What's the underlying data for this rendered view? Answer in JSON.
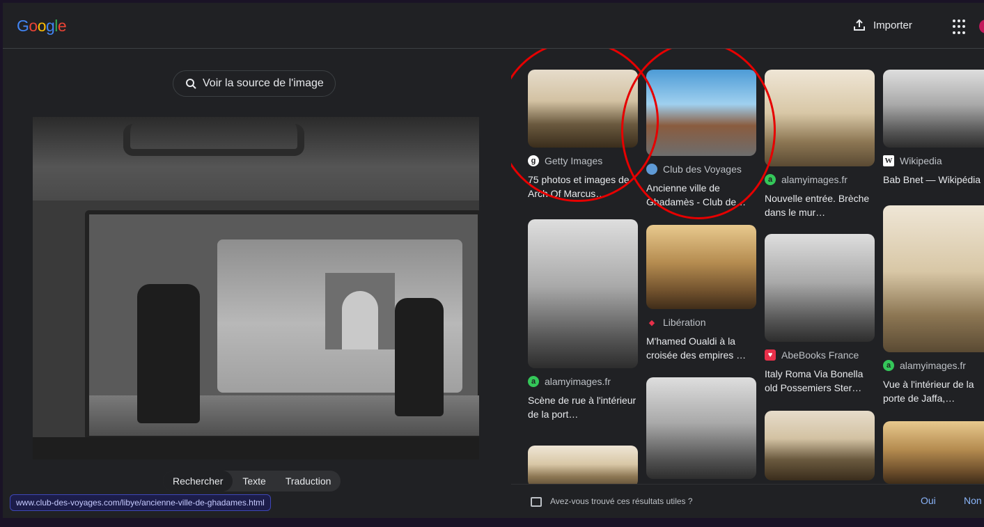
{
  "header": {
    "logo_letters": [
      {
        "ch": "G",
        "color": "#4285f4"
      },
      {
        "ch": "o",
        "color": "#ea4335"
      },
      {
        "ch": "o",
        "color": "#fbbc05"
      },
      {
        "ch": "g",
        "color": "#4285f4"
      },
      {
        "ch": "l",
        "color": "#34a853"
      },
      {
        "ch": "e",
        "color": "#ea4335"
      }
    ],
    "upload_label": "Importer",
    "apps_icon": "grid-apps-icon"
  },
  "left_panel": {
    "source_button_label": "Voir la source de l'image",
    "tabs": [
      {
        "label": "Rechercher",
        "active": true
      },
      {
        "label": "Texte",
        "active": false
      },
      {
        "label": "Traduction",
        "active": false
      }
    ],
    "hover_url": "www.club-des-voyages.com/libye/ancienne-ville-de-ghadames.html"
  },
  "results": [
    {
      "source": "Getty Images",
      "favicon": "g",
      "favicon_color": "#ffffff",
      "title": "75 photos et images de Arch Of Marcus…",
      "thumb_style": "sepia1"
    },
    {
      "source": "Club des Voyages",
      "favicon": "",
      "favicon_color": "#5f9ad6",
      "title": "Ancienne ville de Ghadamès - Club de…",
      "thumb_style": "color1"
    },
    {
      "source": "alamyimages.fr",
      "favicon": "a",
      "favicon_color": "#34c759",
      "title": "Nouvelle entrée. Brèche dans le mur…",
      "thumb_style": "sepia2"
    },
    {
      "source": "Wikipedia",
      "favicon": "W",
      "favicon_color": "#ffffff",
      "title": "Bab Bnet — Wikipédia",
      "thumb_style": "bw1"
    },
    {
      "source": "alamyimages.fr",
      "favicon": "a",
      "favicon_color": "#34c759",
      "title": "Scène de rue à l'intérieur de la port…",
      "thumb_style": "bw1"
    },
    {
      "source": "Libération",
      "favicon": "◆",
      "favicon_color": "#e8304a",
      "title": "M'hamed Oualdi à la croisée des empires …",
      "thumb_style": "warm"
    },
    {
      "source": "AbeBooks France",
      "favicon": "♥",
      "favicon_color": "#e8304a",
      "title": "Italy Roma Via Bonella old Possemiers Ster…",
      "thumb_style": "bw1"
    },
    {
      "source": "alamyimages.fr",
      "favicon": "a",
      "favicon_color": "#34c759",
      "title": "Vue à l'intérieur de la porte de Jaffa,…",
      "thumb_style": "sepia2"
    }
  ],
  "feedback": {
    "question": "Avez-vous trouvé ces résultats utiles ?",
    "yes": "Oui",
    "no": "Non"
  }
}
